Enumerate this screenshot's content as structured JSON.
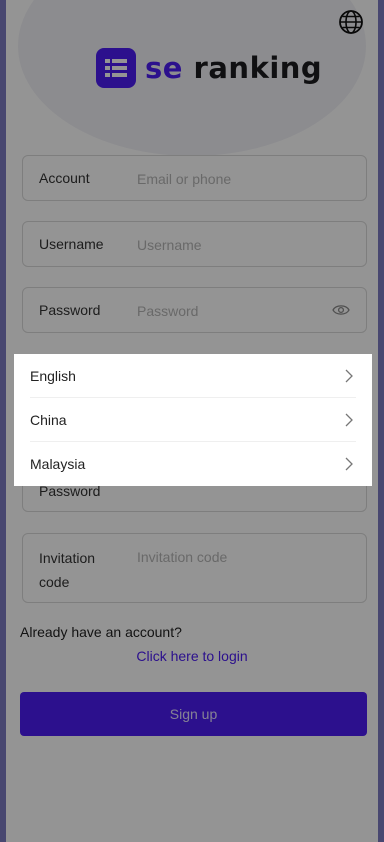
{
  "header": {
    "globe_icon": "globe-icon",
    "logo": {
      "prefix": "se",
      "word": "ranking"
    }
  },
  "form": {
    "account": {
      "label": "Account",
      "placeholder": "Email or phone"
    },
    "username": {
      "label": "Username",
      "placeholder": "Username"
    },
    "password": {
      "label": "Password",
      "placeholder": "Password",
      "toggle_icon": "eye-icon"
    },
    "confirm_password": {
      "label": "Password"
    },
    "invitation": {
      "label": "Invitation code",
      "placeholder": "Invitation code"
    }
  },
  "footer": {
    "already": "Already have an account?",
    "login_link": "Click here to login",
    "signup": "Sign up"
  },
  "language_popup": {
    "items": [
      {
        "label": "English"
      },
      {
        "label": "China"
      },
      {
        "label": "Malaysia"
      }
    ],
    "chevron_icon": "chevron-right-icon"
  },
  "colors": {
    "brand": "#4c1df3",
    "side_strip": "#7c7bc2",
    "overlay": "rgba(0,0,0,0.42)"
  }
}
